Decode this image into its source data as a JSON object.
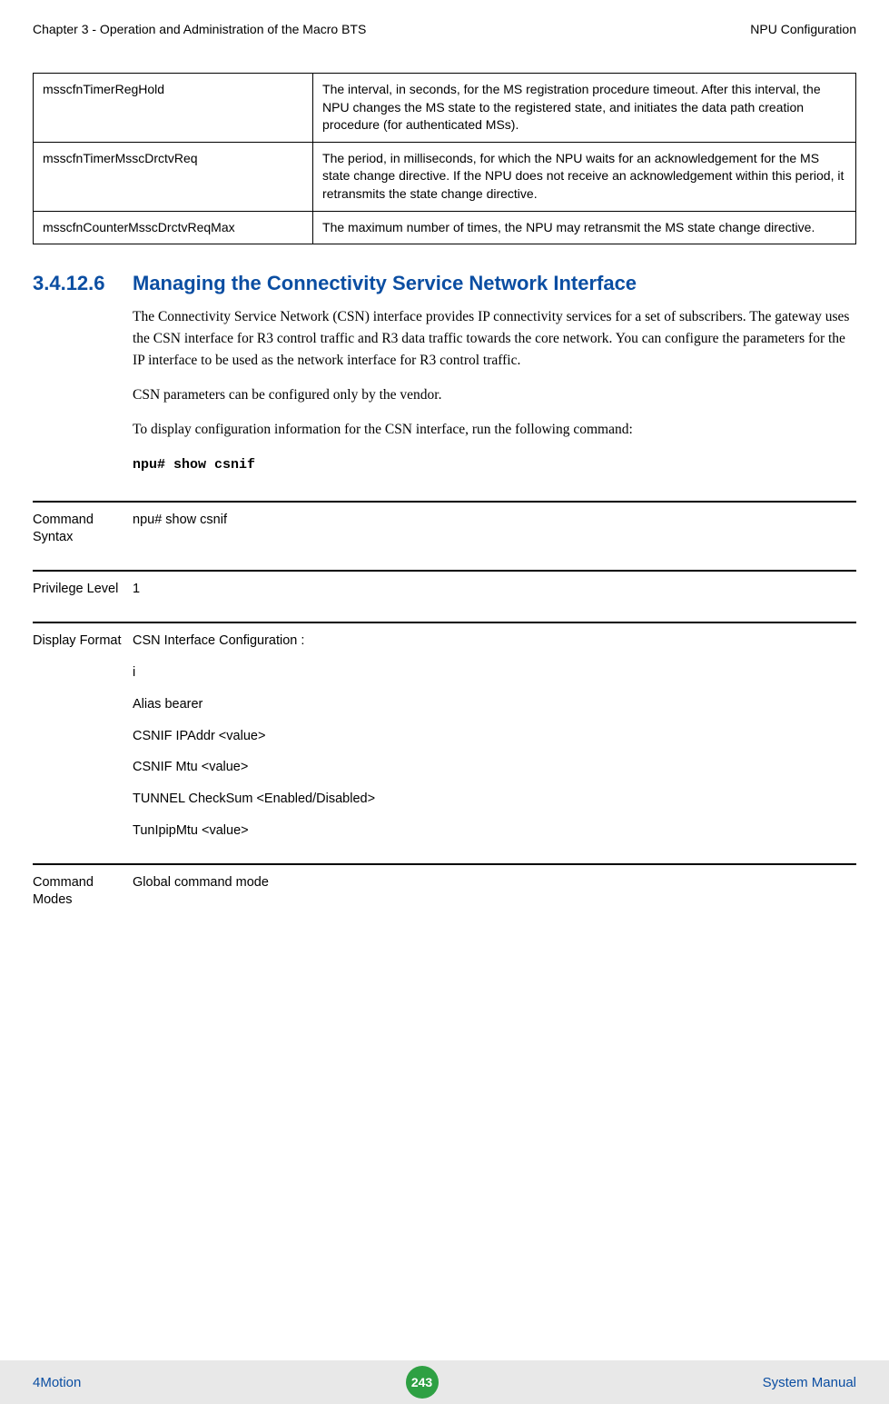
{
  "header": {
    "left": "Chapter 3 - Operation and Administration of the Macro BTS",
    "right": "NPU Configuration"
  },
  "param_table": [
    {
      "name": "msscfnTimerRegHold",
      "desc": "The interval, in seconds, for the MS registration procedure timeout. After this interval, the NPU changes the MS state to the registered state, and initiates the data path creation procedure (for authenticated MSs)."
    },
    {
      "name": "msscfnTimerMsscDrctvReq",
      "desc": "The period, in milliseconds, for which the NPU waits for an acknowledgement for the MS state change directive. If the NPU does not receive an acknowledgement within this period, it retransmits the state change directive."
    },
    {
      "name": "msscfnCounterMsscDrctvReqMax",
      "desc": "The maximum number of times, the NPU may retransmit the MS state change directive."
    }
  ],
  "section": {
    "number": "3.4.12.6",
    "title": "Managing the Connectivity Service Network Interface"
  },
  "body": {
    "p1": "The Connectivity Service Network (CSN) interface provides IP connectivity services for a set of subscribers. The gateway uses the CSN interface for R3 control traffic and R3 data traffic towards the core network. You can configure the parameters for the IP interface to be used as the network interface for R3 control traffic.",
    "p2": "CSN parameters can be configured only by the vendor.",
    "p3": "To display configuration information for the CSN interface, run the following command:",
    "cmd": "npu# show csnif"
  },
  "info": {
    "syntax_label": "Command Syntax",
    "syntax_value": "npu# show csnif",
    "privilege_label": "Privilege Level",
    "privilege_value": "1",
    "display_label": "Display Format",
    "display_lines": {
      "l0": "CSN Interface Configuration :",
      "l1": "i",
      "l2": "Alias bearer",
      "l3": "CSNIF IPAddr <value>",
      "l4": "CSNIF Mtu <value>",
      "l5": "TUNNEL CheckSum <Enabled/Disabled>",
      "l6": "TunIpipMtu  <value>"
    },
    "modes_label": "Command Modes",
    "modes_value": "Global command mode"
  },
  "footer": {
    "left": "4Motion",
    "page": "243",
    "right": "System Manual"
  }
}
